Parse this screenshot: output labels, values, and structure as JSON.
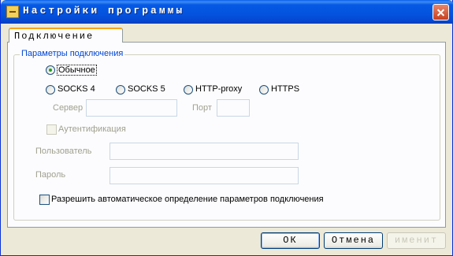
{
  "window": {
    "title": "Настройки программы"
  },
  "tabs": [
    {
      "label": "Подключение"
    }
  ],
  "group": {
    "legend": "Параметры подключения"
  },
  "radios": {
    "normal": "Обычное",
    "socks4": "SOCKS 4",
    "socks5": "SOCKS 5",
    "http_proxy": "HTTP-proxy",
    "https": "HTTPS"
  },
  "fields": {
    "server_label": "Сервер",
    "port_label": "Порт",
    "auth_label": "Аутентификация",
    "user_label": "Пользователь",
    "password_label": "Пароль",
    "server_value": "",
    "port_value": "",
    "user_value": "",
    "password_value": ""
  },
  "auto_detect_label": "Разрешить автоматическое определение параметров подключения",
  "buttons": {
    "ok": "ОК",
    "cancel": "Отмена",
    "apply": "именит"
  },
  "colors": {
    "legend": "#0046d5",
    "titlebar": "#0453de",
    "tab_accent": "#f5a31a"
  }
}
